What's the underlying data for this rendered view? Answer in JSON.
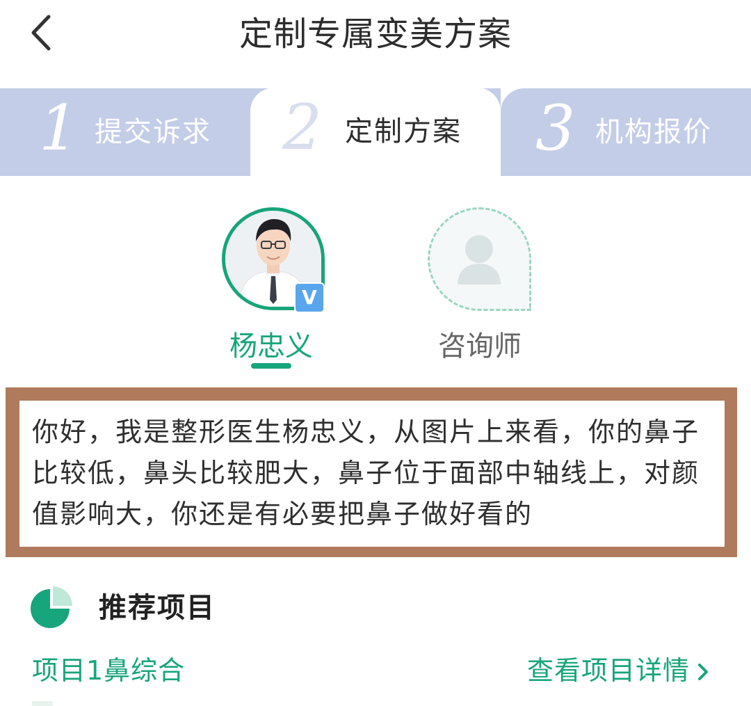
{
  "header": {
    "title": "定制专属变美方案",
    "back_icon": "chevron-left-icon"
  },
  "steps": [
    {
      "number": "1",
      "label": "提交诉求",
      "active": false
    },
    {
      "number": "2",
      "label": "定制方案",
      "active": true
    },
    {
      "number": "3",
      "label": "机构报价",
      "active": false
    }
  ],
  "advisors": {
    "doctor": {
      "name": "杨忠义",
      "badge": "V",
      "selected": true
    },
    "consultant": {
      "name": "咨询师",
      "selected": false
    }
  },
  "message": {
    "text": "你好，我是整形医生杨忠义，从图片上来看，你的鼻子比较低，鼻头比较肥大，鼻子位于面部中轴线上，对颜值影响大，你还是有必要把鼻子做好看的"
  },
  "recommend": {
    "title": "推荐项目",
    "icon": "pie-chart-icon",
    "project_name": "项目1鼻综合",
    "detail_link": "查看项目详情"
  },
  "colors": {
    "accent": "#17a57b",
    "steps_bg": "#c3cde8",
    "message_frame": "#b07a5c"
  }
}
